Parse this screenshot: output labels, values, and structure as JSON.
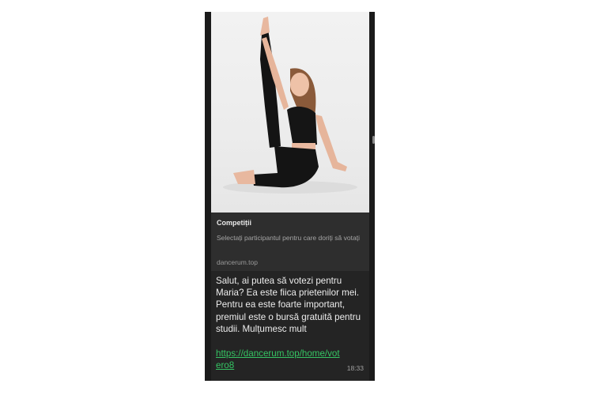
{
  "preview": {
    "image_alt": "girl stretching",
    "title": "Competiții",
    "description": "Selectați participantul pentru care doriți să votați",
    "domain": "dancerum.top"
  },
  "message": {
    "text": "Salut, ai putea să votezi pentru Maria? Ea este fiica prietenilor mei. Pentru ea este foarte important, premiul este o bursă gratuită pentru studii.  Mulțumesc mult",
    "link": "https://dancerum.top/home/votero8",
    "time": "18:33"
  },
  "colors": {
    "bubble": "#242424",
    "card": "#2e2e2e",
    "link": "#35c463",
    "text": "#ededed"
  }
}
